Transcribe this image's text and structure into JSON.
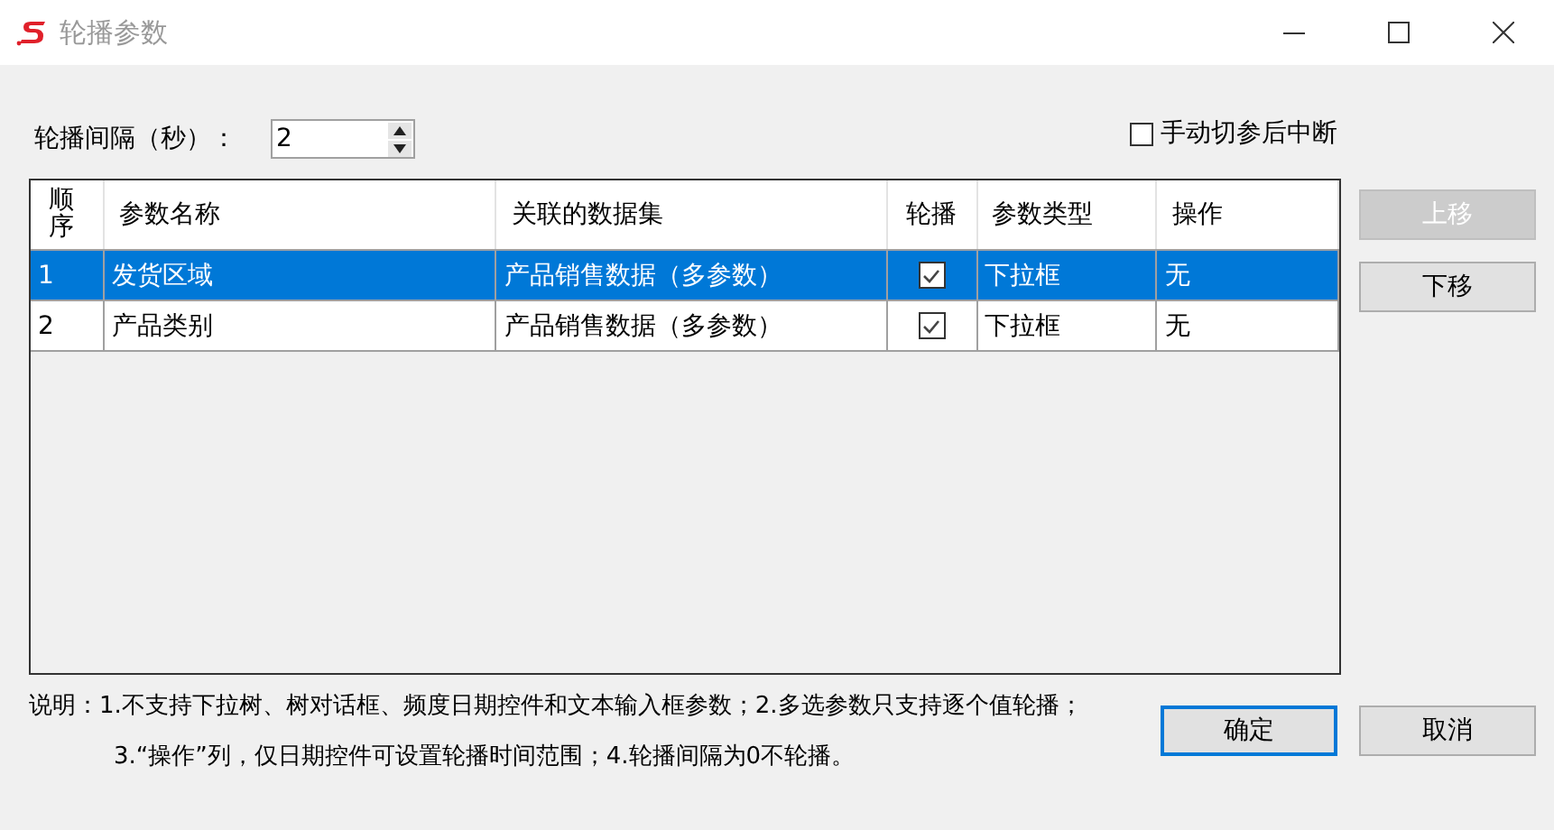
{
  "window": {
    "title": "轮播参数"
  },
  "interval": {
    "label": "轮播间隔（秒）：",
    "value": "2"
  },
  "interrupt": {
    "label": "手动切参后中断",
    "checked": false
  },
  "table": {
    "columns": [
      "顺序",
      "参数名称",
      "关联的数据集",
      "轮播",
      "参数类型",
      "操作"
    ],
    "rows": [
      {
        "order": "1",
        "name": "发货区域",
        "dataset": "产品销售数据（多参数）",
        "carousel": true,
        "type": "下拉框",
        "action": "无",
        "selected": true
      },
      {
        "order": "2",
        "name": "产品类别",
        "dataset": "产品销售数据（多参数）",
        "carousel": true,
        "type": "下拉框",
        "action": "无",
        "selected": false
      }
    ]
  },
  "side_buttons": [
    {
      "label": "上移",
      "disabled": true
    },
    {
      "label": "下移",
      "disabled": false
    }
  ],
  "notes": [
    "说明：1.不支持下拉树、树对话框、频度日期控件和文本输入框参数；2.多选参数只支持逐个值轮播；",
    "3.“操作”列，仅日期控件可设置轮播时间范围；4.轮播间隔为0不轮播。"
  ],
  "buttons": [
    {
      "label": "确定",
      "default": true
    },
    {
      "label": "取消",
      "default": false
    }
  ]
}
